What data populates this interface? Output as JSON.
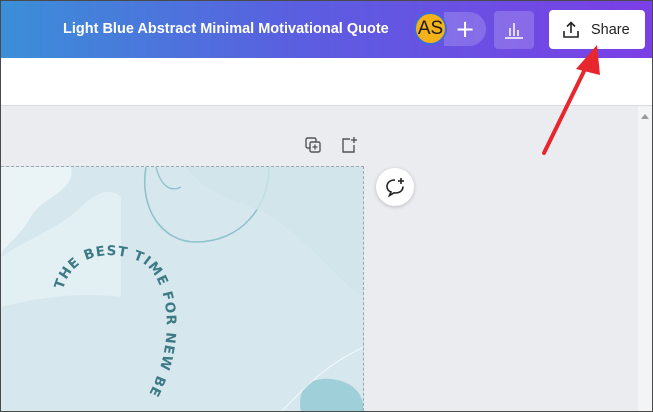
{
  "header": {
    "doc_title": "Light Blue Abstract Minimal Motivational Quote",
    "avatar_initials": "AS",
    "add_label": "+",
    "share_label": "Share"
  },
  "canvas": {
    "quote_text": "THE BEST TIME FOR NEW BE"
  },
  "colors": {
    "header_gradient_start": "#3b8fd8",
    "header_gradient_end": "#7b3fe6",
    "avatar": "#f3b21a",
    "canvas_bg": "#d6e8ee",
    "quote_text": "#3d7a85",
    "annotation_arrow": "#e8262d"
  },
  "icons": {
    "share": "upload-icon",
    "insights": "bar-chart-icon",
    "duplicate_page": "duplicate-page-icon",
    "add_page": "add-page-icon",
    "comment": "add-comment-icon"
  }
}
